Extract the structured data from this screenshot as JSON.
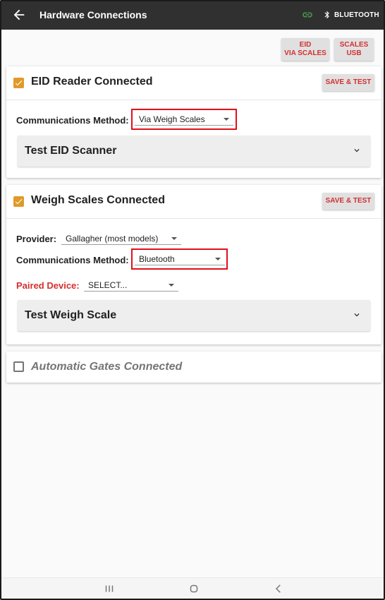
{
  "appbar": {
    "title": "Hardware Connections",
    "bluetooth_label": "BLUETOOTH",
    "icons": [
      "back-arrow-icon",
      "link-icon",
      "bluetooth-icon"
    ],
    "link_color": "#4caf50"
  },
  "top_buttons": [
    {
      "line1": "EID",
      "line2": "VIA SCALES"
    },
    {
      "line1": "SCALES",
      "line2": "USB"
    }
  ],
  "eid_card": {
    "title": "EID Reader Connected",
    "checked": true,
    "save_label": "SAVE & TEST",
    "comm_label": "Communications Method:",
    "comm_value": "Via Weigh Scales",
    "test_label": "Test EID Scanner"
  },
  "scales_card": {
    "title": "Weigh Scales Connected",
    "checked": true,
    "save_label": "SAVE & TEST",
    "provider_label": "Provider:",
    "provider_value": "Gallagher (most models)",
    "comm_label": "Communications Method:",
    "comm_value": "Bluetooth",
    "paired_label": "Paired Device:",
    "paired_value": "SELECT...",
    "test_label": "Test Weigh Scale"
  },
  "gates_card": {
    "title": "Automatic Gates Connected",
    "checked": false
  },
  "nav": {
    "icons": [
      "recent-apps-icon",
      "home-icon",
      "back-icon"
    ]
  },
  "colors": {
    "accent_red": "#d32f2f",
    "checkbox_orange": "#e09a2a",
    "appbar": "#303030",
    "highlight_red": "#e0101a"
  }
}
